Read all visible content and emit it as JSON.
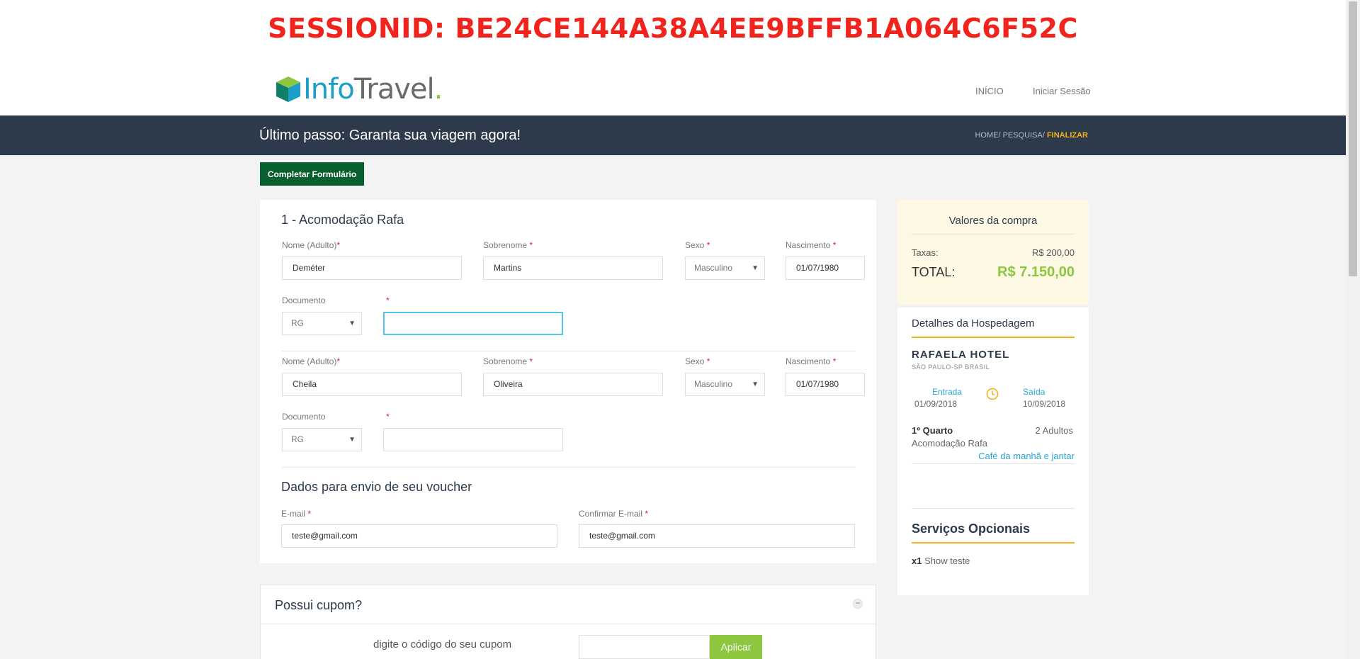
{
  "session": {
    "text": "SESSIONID: BE24CE144A38A4EE9BFFB1A064C6F52C"
  },
  "logo": {
    "part1": "Info",
    "part2": "Trave",
    "part3": "l",
    "dot": "."
  },
  "nav": {
    "home": "INÍCIO",
    "login": "Iniciar Sessão"
  },
  "header": {
    "title": "Último passo: Garanta sua viagem agora!",
    "breadcrumb": {
      "home": "HOME/",
      "search": "PESQUISA/",
      "current": "FINALIZAR"
    }
  },
  "actions": {
    "fill_form": "Completar Formulário"
  },
  "form": {
    "accommodation_title": "1 - Acomodação Rafa",
    "labels": {
      "name": "Nome (Adulto)",
      "surname": "Sobrenome",
      "sex": "Sexo",
      "birth": "Nascimento",
      "document": "Documento",
      "required": "*"
    },
    "guests": [
      {
        "name": "Deméter",
        "surname": "Martins",
        "sex": "Masculino",
        "birth": "01/07/1980",
        "doc_type": "RG",
        "doc_number": ""
      },
      {
        "name": "Cheila",
        "surname": "Oliveira",
        "sex": "Masculino",
        "birth": "01/07/1980",
        "doc_type": "RG",
        "doc_number": ""
      }
    ],
    "voucher_title": "Dados para envio de seu voucher",
    "email_label": "E-mail",
    "confirm_email_label": "Confirmar E-mail",
    "email": "teste@gmail.com",
    "confirm_email": "teste@gmail.com"
  },
  "coupon": {
    "title": "Possui cupom?",
    "collapse": "−",
    "hint": "digite o código do seu cupom",
    "apply": "Aplicar"
  },
  "summary": {
    "title": "Valores da compra",
    "taxes_label": "Taxas:",
    "taxes_value": "R$ 200,00",
    "total_label": "TOTAL:",
    "total_value": "R$ 7.150,00"
  },
  "details": {
    "title": "Detalhes da Hospedagem",
    "hotel": "RAFAELA HOTEL",
    "location": "SÃO PAULO-SP BRASIL",
    "checkin_label": "Entrada",
    "checkin": "01/09/2018",
    "checkout_label": "Saída",
    "checkout": "10/09/2018",
    "room": "1º Quarto",
    "adults": "2 Adultos",
    "accommodation": "Acomodação Rafa",
    "meal": "Café da manhã e jantar",
    "services_title": "Serviços Opcionais",
    "service_qty": "x1",
    "service_name": "Show teste"
  },
  "colors": {
    "accent": "#f3b21a",
    "header": "#2d3a4b",
    "green": "#8dc63f",
    "button": "#09602f",
    "session": "#f0241c"
  }
}
